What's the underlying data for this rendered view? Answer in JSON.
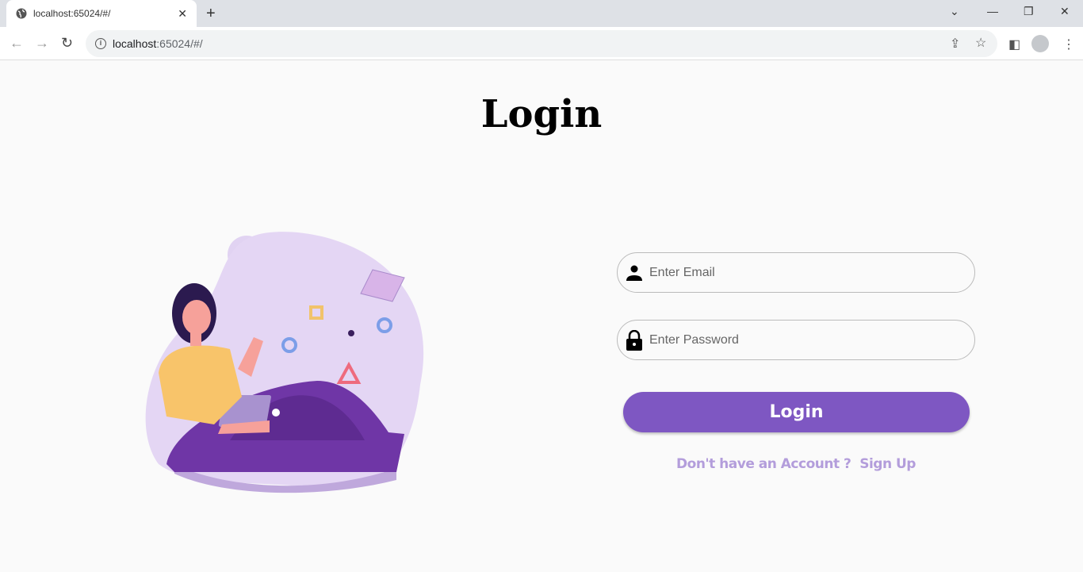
{
  "browser": {
    "tab_title": "localhost:65024/#/",
    "url_host": "localhost",
    "url_rest": ":65024/#/"
  },
  "page": {
    "title": "Login",
    "email_placeholder": "Enter Email",
    "password_placeholder": "Enter Password",
    "login_button": "Login",
    "no_account": "Don't have an Account ?",
    "sign_up": "Sign Up"
  },
  "colors": {
    "accent": "#7e57c2",
    "link": "#b39ddb"
  },
  "icons": {
    "email": "person-icon",
    "password": "lock-icon"
  }
}
